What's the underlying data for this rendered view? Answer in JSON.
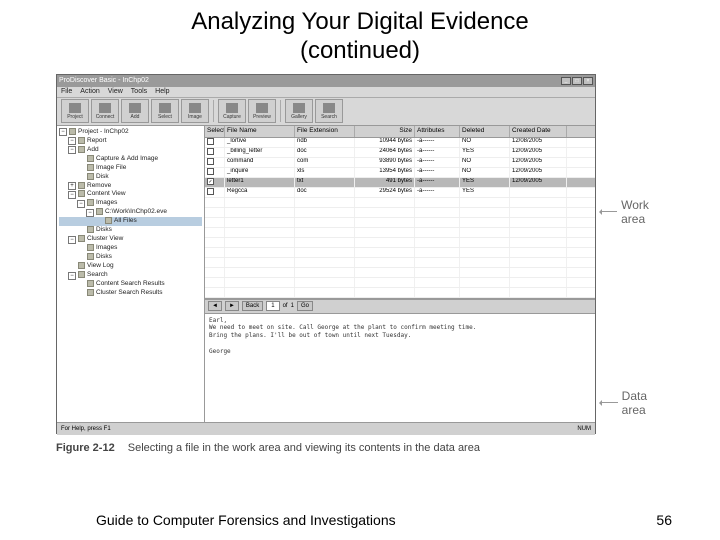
{
  "slide": {
    "title_line1": "Analyzing Your Digital Evidence",
    "title_line2": "(continued)",
    "footer_text": "Guide to Computer Forensics and Investigations",
    "page_number": "56"
  },
  "figure": {
    "number": "Figure 2-12",
    "caption": "Selecting a file in the work area and viewing its contents in the data area"
  },
  "annotations": {
    "work_area": "Work area",
    "data_area": "Data area"
  },
  "app": {
    "title": "ProDiscover Basic - InChp02",
    "menu": [
      "File",
      "Action",
      "View",
      "Tools",
      "Help"
    ],
    "toolbar": [
      {
        "label": "Project"
      },
      {
        "label": "Connect"
      },
      {
        "label": "Add"
      },
      {
        "label": "Select"
      },
      {
        "label": "Image"
      },
      {
        "sep": true
      },
      {
        "label": "Capture"
      },
      {
        "label": "Preview"
      },
      {
        "sep": true
      },
      {
        "label": "Gallery"
      },
      {
        "label": "Search"
      }
    ],
    "tree": [
      {
        "indent": 0,
        "exp": "−",
        "label": "Project - InChp02"
      },
      {
        "indent": 1,
        "exp": "−",
        "label": "Report"
      },
      {
        "indent": 1,
        "exp": "−",
        "label": "Add"
      },
      {
        "indent": 2,
        "exp": "",
        "label": "Capture & Add Image"
      },
      {
        "indent": 2,
        "exp": "",
        "label": "Image File"
      },
      {
        "indent": 2,
        "exp": "",
        "label": "Disk"
      },
      {
        "indent": 1,
        "exp": "+",
        "label": "Remove"
      },
      {
        "indent": 1,
        "exp": "−",
        "label": "Content View"
      },
      {
        "indent": 2,
        "exp": "−",
        "label": "Images"
      },
      {
        "indent": 3,
        "exp": "−",
        "label": "C:\\Work\\InChp02.eve"
      },
      {
        "indent": 4,
        "exp": "",
        "label": "All Files",
        "sel": true
      },
      {
        "indent": 2,
        "exp": "",
        "label": "Disks"
      },
      {
        "indent": 1,
        "exp": "−",
        "label": "Cluster View"
      },
      {
        "indent": 2,
        "exp": "",
        "label": "Images"
      },
      {
        "indent": 2,
        "exp": "",
        "label": "Disks"
      },
      {
        "indent": 1,
        "exp": "",
        "label": "View Log"
      },
      {
        "indent": 1,
        "exp": "−",
        "label": "Search"
      },
      {
        "indent": 2,
        "exp": "",
        "label": "Content Search Results"
      },
      {
        "indent": 2,
        "exp": "",
        "label": "Cluster Search Results"
      }
    ],
    "columns": [
      "Select",
      "File Name",
      "File Extension",
      "Size",
      "Attributes",
      "Deleted",
      "Created Date"
    ],
    "rows": [
      {
        "sel": false,
        "chk": "",
        "name": "_lortive",
        "ext": "ndb",
        "size": "10944 bytes",
        "attr": "-a------",
        "del": "NO",
        "date": "12/08/2005"
      },
      {
        "sel": false,
        "chk": "",
        "name": "_billing_letter",
        "ext": "doc",
        "size": "24064 bytes",
        "attr": "-a------",
        "del": "YES",
        "date": "12/09/2005"
      },
      {
        "sel": false,
        "chk": "",
        "name": "command",
        "ext": "com",
        "size": "93890 bytes",
        "attr": "-a------",
        "del": "NO",
        "date": "12/09/2005"
      },
      {
        "sel": false,
        "chk": "",
        "name": "_inquire",
        "ext": "xls",
        "size": "13954 bytes",
        "attr": "-a------",
        "del": "NO",
        "date": "12/09/2005"
      },
      {
        "sel": true,
        "chk": "✓",
        "name": "letter1",
        "ext": "txt",
        "size": "491 bytes",
        "attr": "-a------",
        "del": "YES",
        "date": "12/09/2005"
      },
      {
        "sel": false,
        "chk": "",
        "name": "Regcca",
        "ext": "doc",
        "size": "29524 bytes",
        "attr": "-a------",
        "del": "YES",
        "date": ""
      }
    ],
    "data_toolbar": {
      "prev": "◄",
      "next": "►",
      "back": "Back",
      "field": "1",
      "of_label": "of",
      "of": "1",
      "go": "Go"
    },
    "data_content": [
      "Earl,",
      "We need to meet on site. Call George at the plant to confirm meeting time.",
      "Bring the plans. I'll be out of town until next Tuesday.",
      "",
      "George"
    ],
    "status": {
      "left": "For Help, press F1",
      "mid": "",
      "right": "NUM"
    }
  }
}
